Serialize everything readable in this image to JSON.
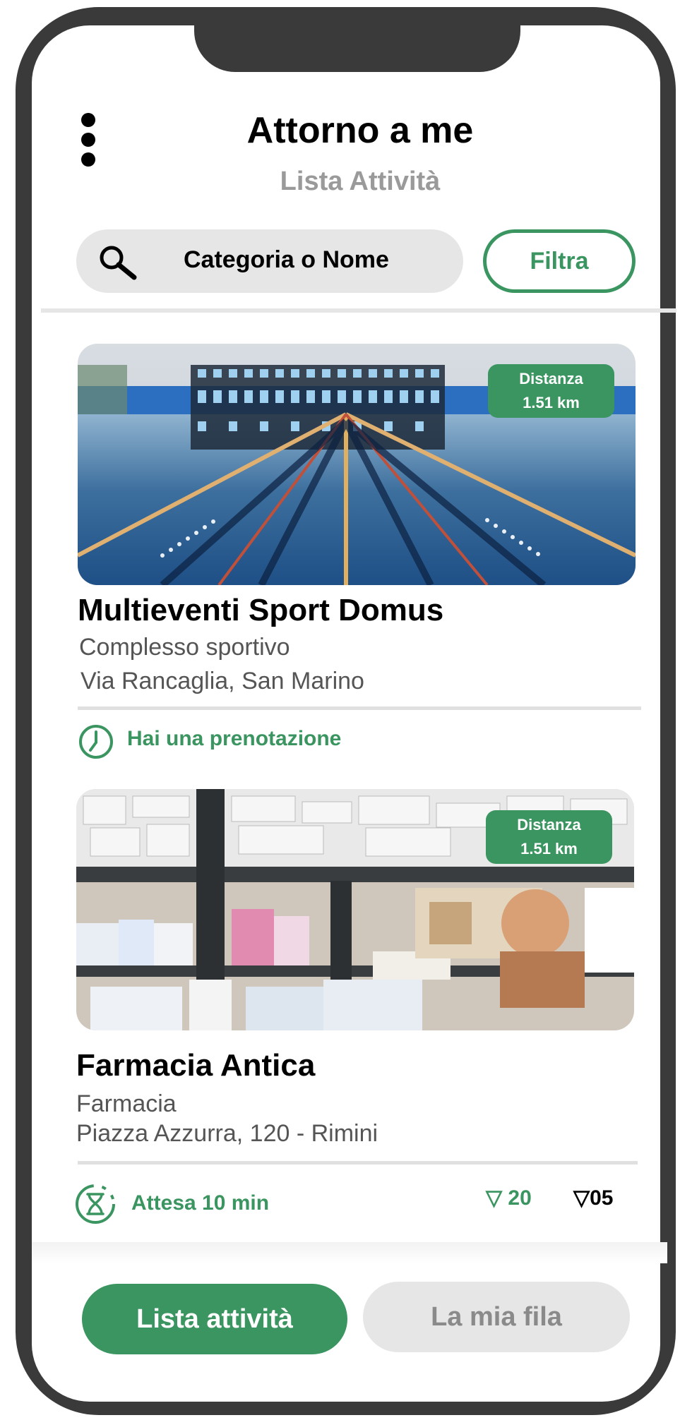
{
  "header": {
    "title": "Attorno a me",
    "subtitle": "Lista Attività"
  },
  "search": {
    "placeholder": "Categoria o Nome",
    "filter_label": "Filtra"
  },
  "cards": [
    {
      "name": "Multieventi Sport Domus",
      "category": "Complesso sportivo",
      "address": "Via Rancaglia, San Marino",
      "distance_label": "Distanza",
      "distance_value": "1.51 km",
      "status": "Hai una prenotazione",
      "status_icon": "clock-icon",
      "image": "swimming-pool"
    },
    {
      "name": "Farmacia Antica",
      "category": "Farmacia",
      "address": "Piazza Azzurra, 120 - Rimini",
      "distance_label": "Distanza",
      "distance_value": "1.51 km",
      "status": "Attesa 10 min",
      "status_icon": "hourglass-icon",
      "image": "pharmacy-shelves",
      "votes_green": "20",
      "votes_black": "05"
    }
  ],
  "bottom_nav": {
    "active": "Lista attività",
    "inactive": "La mia fila"
  },
  "colors": {
    "accent": "#3b9560",
    "frame": "#3a3a3a",
    "muted": "#9a9a9a"
  }
}
